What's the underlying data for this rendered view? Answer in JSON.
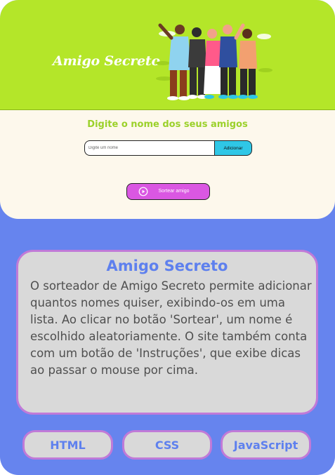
{
  "header": {
    "app_title": "Amigo Secreto",
    "illustration_icon": "group-of-friends-illustration"
  },
  "colors": {
    "header_bg": "#b4e629",
    "page_bg": "#6684ee",
    "card_bg": "#fdf8ec",
    "accent_green": "#9bd12a",
    "add_button": "#2fc7e6",
    "draw_button": "#da57e2",
    "info_border": "#c07ad8",
    "info_title": "#5e80ee"
  },
  "form": {
    "section_title": "Digite o nome dos seus amigos",
    "input_placeholder": "Digite um nome",
    "input_value": "",
    "add_label": "Adicionar",
    "draw_label": "Sortear amigo",
    "draw_icon": "play-circle-icon"
  },
  "info": {
    "title": "Amigo Secreto",
    "text": "O sorteador de Amigo Secreto permite adicionar quantos nomes quiser, exibindo-os em uma lista. Ao clicar no botão 'Sortear', um nome é escolhido aleatoriamente. O site também conta com um botão de 'Instruções', que exibe dicas ao passar o mouse por cima."
  },
  "tech": [
    "HTML",
    "CSS",
    "JavaScript"
  ]
}
